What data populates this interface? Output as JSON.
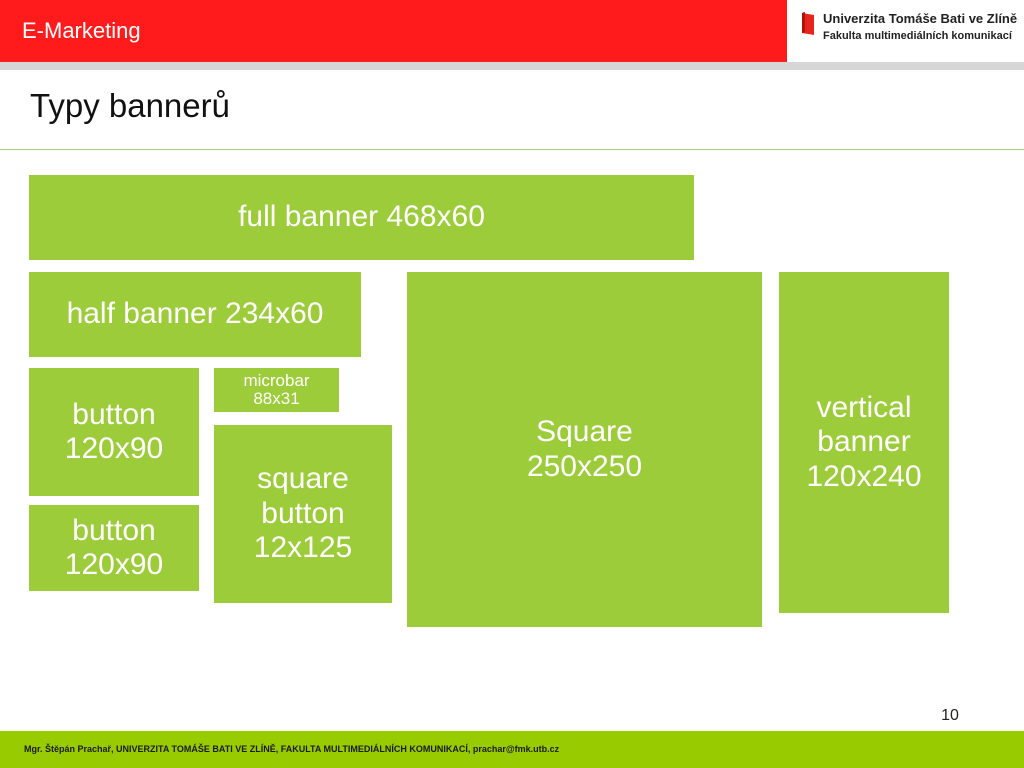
{
  "header": {
    "title": "E-Marketing",
    "logo_line1": "Univerzita Tomáše Bati ve Zlíně",
    "logo_line2": "Fakulta multimediálních komunikací"
  },
  "slide": {
    "title": "Typy bannerů",
    "page_number": "10"
  },
  "banners": {
    "full": "full banner 468x60",
    "half": "half banner 234x60",
    "button1": "button\n120x90",
    "button2": "button\n120x90",
    "microbar": "microbar\n88x31",
    "square_button": "square\nbutton\n12x125",
    "square": "Square\n250x250",
    "vertical": "vertical\nbanner\n120x240"
  },
  "footer": {
    "text": "Mgr. Štěpán Prachař, UNIVERZITA TOMÁŠE BATI VE ZLÍNĚ, FAKULTA MULTIMEDIÁLNÍCH KOMUNIKACÍ, prachar@fmk.utb.cz"
  },
  "colors": {
    "header_red": "#ff1b1b",
    "banner_green": "#9dcc3a",
    "footer_green": "#99cc00"
  }
}
